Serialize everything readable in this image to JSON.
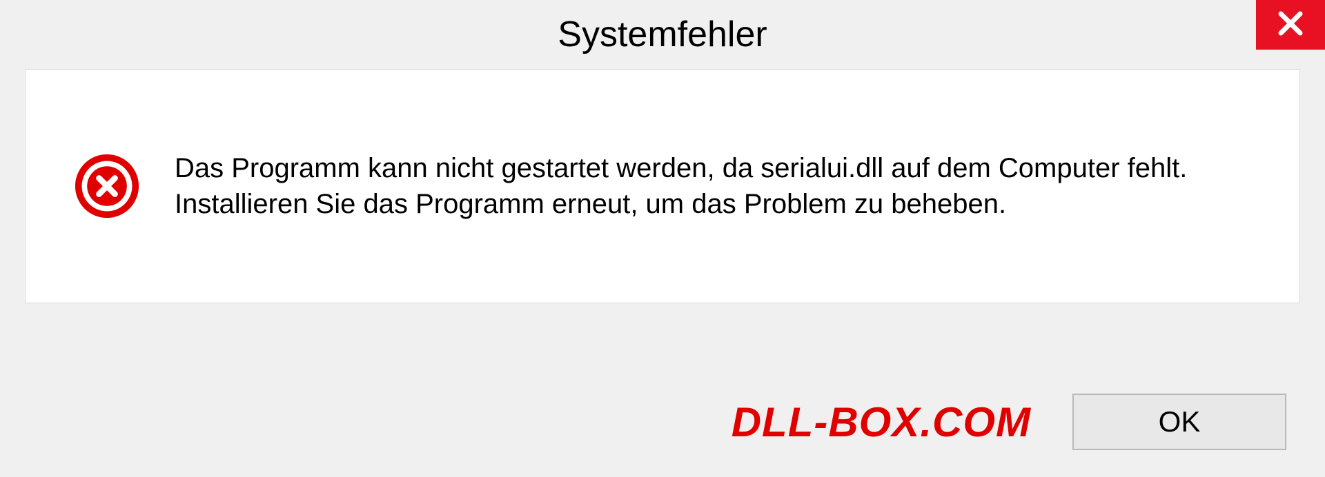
{
  "dialog": {
    "title": "Systemfehler",
    "message": "Das Programm kann nicht gestartet werden, da serialui.dll auf dem Computer fehlt. Installieren Sie das Programm erneut, um das Problem zu beheben.",
    "ok_label": "OK",
    "watermark": "DLL-BOX.COM"
  }
}
